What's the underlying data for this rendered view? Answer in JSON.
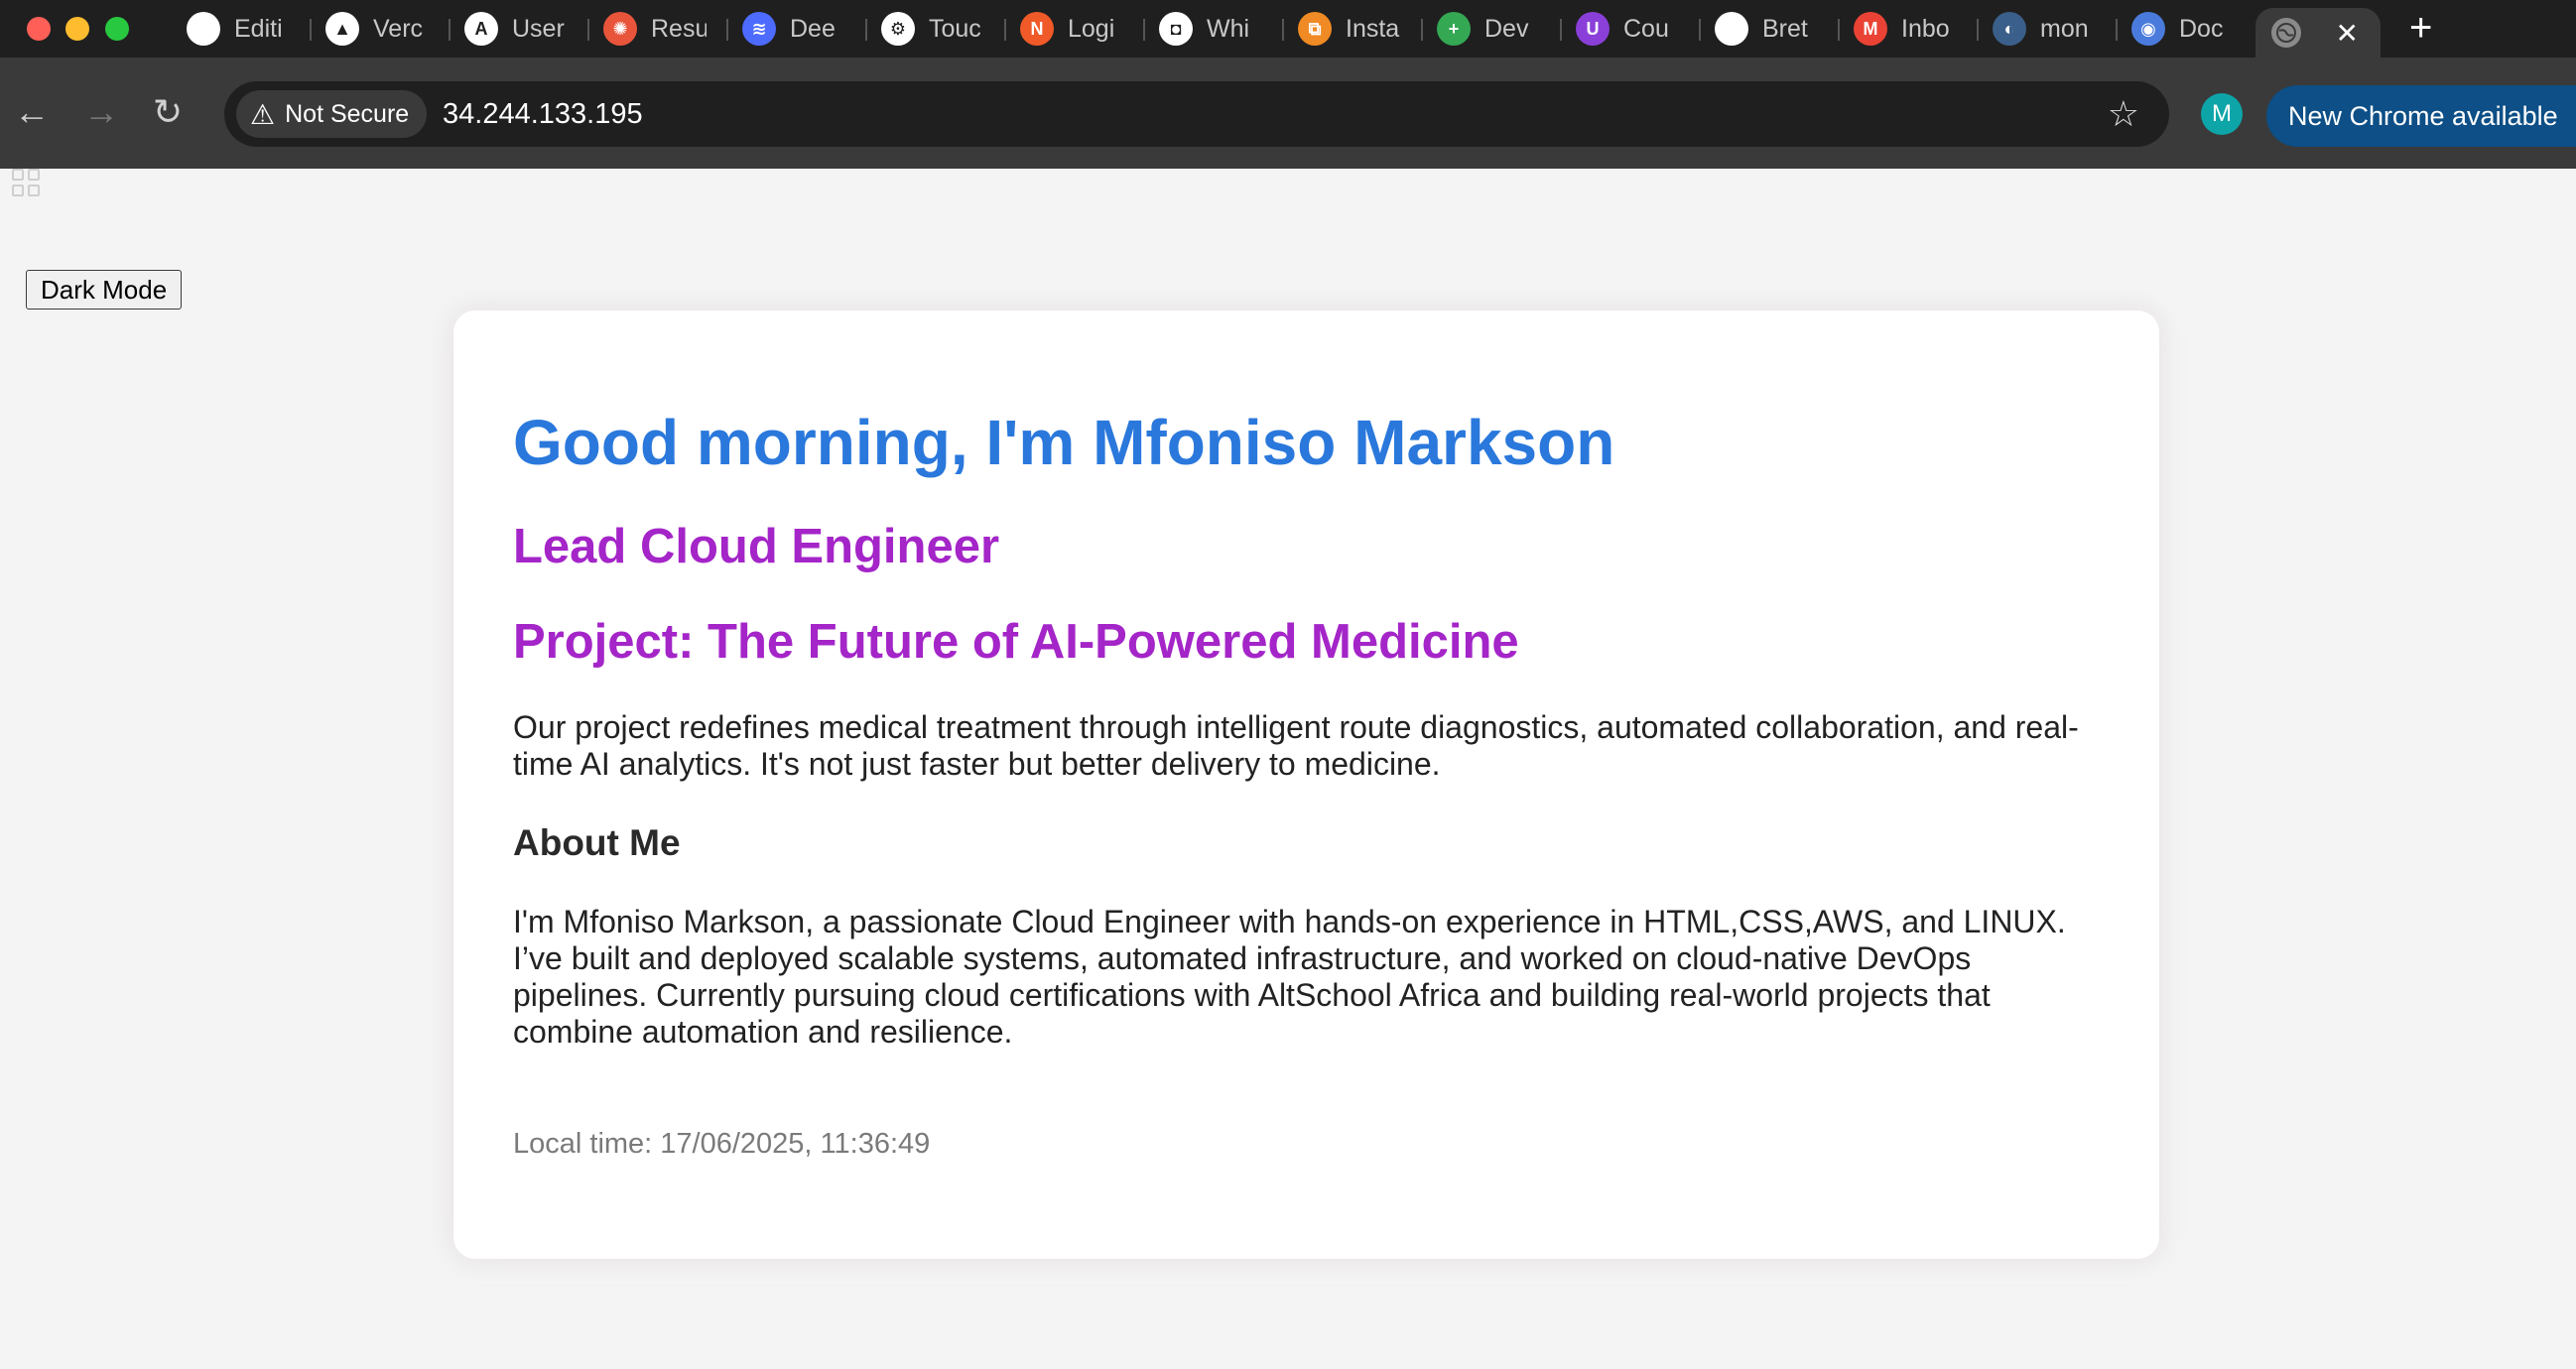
{
  "browser": {
    "tabs": [
      {
        "label": "Editi",
        "icon": "github-icon",
        "color": "#ffffff",
        "glyph": ""
      },
      {
        "label": "Verc",
        "icon": "vercel-icon",
        "color": "#ffffff",
        "glyph": "▲"
      },
      {
        "label": "User",
        "icon": "a-logo-icon",
        "color": "#ffffff",
        "glyph": "A"
      },
      {
        "label": "Resu",
        "icon": "sunburst-icon",
        "color": "#e8553b",
        "glyph": "✺"
      },
      {
        "label": "Dee",
        "icon": "deepseek-icon",
        "color": "#4d6bfe",
        "glyph": "≋"
      },
      {
        "label": "Touc",
        "icon": "openai-icon",
        "color": "#ffffff",
        "glyph": "⚙"
      },
      {
        "label": "Logi",
        "icon": "login-orange-icon",
        "color": "#f05a28",
        "glyph": "N"
      },
      {
        "label": "Whi",
        "icon": "whi-icon",
        "color": "#ffffff",
        "glyph": "◘"
      },
      {
        "label": "Insta",
        "icon": "instance-orange-icon",
        "color": "#f08a24",
        "glyph": "⧉"
      },
      {
        "label": "Dev",
        "icon": "green-sheet-icon",
        "color": "#34a853",
        "glyph": "+"
      },
      {
        "label": "Cou",
        "icon": "course-purple-icon",
        "color": "#8b3fd9",
        "glyph": "U"
      },
      {
        "label": "Bret",
        "icon": "github-icon",
        "color": "#ffffff",
        "glyph": ""
      },
      {
        "label": "Inbo",
        "icon": "gmail-icon",
        "color": "#ea4335",
        "glyph": "M"
      },
      {
        "label": "mon",
        "icon": "circle-logo-icon",
        "color": "#3a5f8a",
        "glyph": "◐"
      },
      {
        "label": "Doc",
        "icon": "docker-icon",
        "color": "#4a7bdc",
        "glyph": "◉"
      }
    ],
    "active_tab_close": "✕",
    "new_tab": "+",
    "security_label": "Not Secure",
    "url": "34.244.133.195",
    "profile_initial": "M",
    "update_label": "New Chrome available"
  },
  "page": {
    "theme_toggle_label": "Dark Mode",
    "greeting": "Good morning, I'm Mfoniso Markson",
    "role": "Lead Cloud Engineer",
    "project_title": "Project: The Future of AI-Powered Medicine",
    "project_summary": "Our project redefines medical treatment through intelligent route diagnostics, automated collaboration, and real-time AI analytics. It's not just faster but better delivery to medicine.",
    "about_heading": "About Me",
    "about_text": "I'm Mfoniso Markson, a passionate Cloud Engineer with hands-on experience in HTML,CSS,AWS, and LINUX. I’ve built and deployed scalable systems, automated infrastructure, and worked on cloud-native DevOps pipelines. Currently pursuing cloud certifications with AltSchool Africa and building real-world projects that combine automation and resilience.",
    "local_time": "Local time: 17/06/2025, 11:36:49"
  },
  "colors": {
    "greeting": "#2a78dc",
    "accent_purple": "#a425c8",
    "update_button": "#0d4f86"
  }
}
